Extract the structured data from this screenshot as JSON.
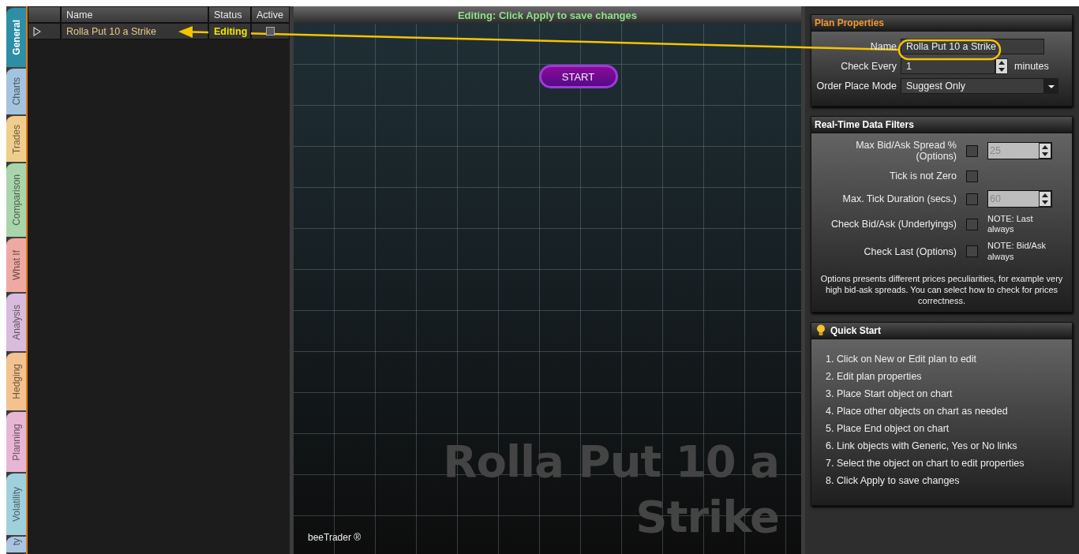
{
  "side_tabs": [
    {
      "label": "General",
      "selected": true,
      "color": "#2e8ea6"
    },
    {
      "label": "Charts",
      "selected": false,
      "color": "#a3c3de"
    },
    {
      "label": "Trades",
      "selected": false,
      "color": "#f1cd8c"
    },
    {
      "label": "Comparison",
      "selected": false,
      "color": "#a9d5aa"
    },
    {
      "label": "What If",
      "selected": false,
      "color": "#eeaaa2"
    },
    {
      "label": "Analysis",
      "selected": false,
      "color": "#d9bbdd"
    },
    {
      "label": "Hedging",
      "selected": false,
      "color": "#f3c28e"
    },
    {
      "label": "Planning",
      "selected": false,
      "color": "#e7b6d5"
    },
    {
      "label": "Volatility",
      "selected": false,
      "color": "#9fd0dd"
    },
    {
      "label": "ty",
      "selected": false,
      "color": "#a9c5e2"
    }
  ],
  "plans_table": {
    "columns": [
      "Name",
      "Status",
      "Active"
    ],
    "rows": [
      {
        "name": "Rolla Put 10 a Strike",
        "status": "Editing",
        "active": false
      }
    ]
  },
  "canvas": {
    "status_message": "Editing:  Click Apply to save changes",
    "start_node": "START",
    "watermark": "Rolla Put 10 a Strike",
    "brand": "beeTrader ®"
  },
  "plan_properties": {
    "title": "Plan Properties",
    "name_label": "Name",
    "name_value": "Rolla Put 10 a Strike",
    "check_every_label": "Check Every",
    "check_every_value": "1",
    "check_every_unit": "minutes",
    "order_mode_label": "Order Place Mode",
    "order_mode_value": "Suggest Only"
  },
  "data_filters": {
    "title": "Real-Time Data Filters",
    "filters": [
      {
        "label": "Max Bid/Ask Spread % (Options)",
        "checked": false,
        "value": "25"
      },
      {
        "label": "Tick is not Zero",
        "checked": false
      },
      {
        "label": "Max. Tick Duration (secs.)",
        "checked": false,
        "value": "60"
      },
      {
        "label": "Check Bid/Ask (Underlyings)",
        "checked": false,
        "note": "NOTE: Last always"
      },
      {
        "label": "Check Last (Options)",
        "checked": false,
        "note": "NOTE: Bid/Ask always"
      }
    ],
    "description": "Options presents different prices peculiarities, for example very high bid-ask spreads. You can select how to check for prices correctness."
  },
  "quick_start": {
    "title": "Quick Start",
    "steps": [
      "1. Click on New or Edit plan to edit",
      "2. Edit plan properties",
      "3. Place Start object on chart",
      "4. Place other objects on chart as needed",
      "5. Place End object on chart",
      "6. Link objects with Generic, Yes or No links",
      "7. Select the object on chart to edit properties",
      "8. Click Apply to save changes"
    ]
  }
}
